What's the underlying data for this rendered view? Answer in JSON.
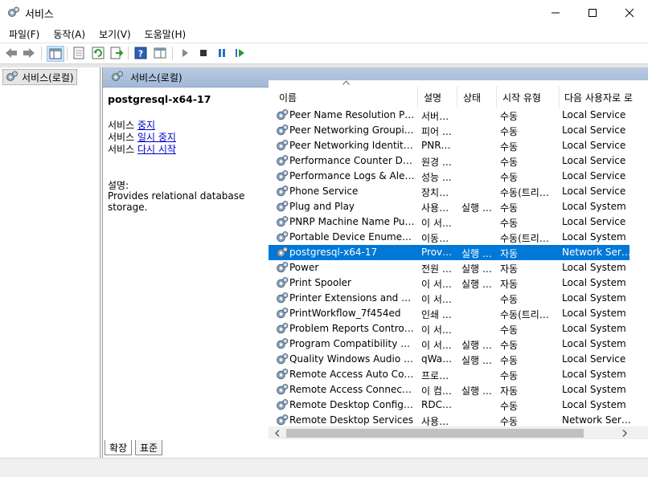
{
  "window": {
    "title": "서비스"
  },
  "menu": [
    "파일(F)",
    "동작(A)",
    "보기(V)",
    "도움말(H)"
  ],
  "tree": {
    "root_label": "서비스(로컬)"
  },
  "panel": {
    "header": "서비스(로컬)"
  },
  "detail": {
    "service_name": "postgresql-x64-17",
    "prefix": "서비스 ",
    "actions": [
      "중지",
      "일시 중지",
      "다시 시작"
    ],
    "desc_label": "설명:",
    "desc_text": "Provides relational database storage."
  },
  "columns": [
    "이름",
    "설명",
    "상태",
    "시작 유형",
    "다음 사용자로 로"
  ],
  "rows": [
    {
      "name": "Peer Name Resolution Prot…",
      "desc": "서버…",
      "status": "",
      "start": "수동",
      "logon": "Local Service"
    },
    {
      "name": "Peer Networking Grouping",
      "desc": "피어 …",
      "status": "",
      "start": "수동",
      "logon": "Local Service"
    },
    {
      "name": "Peer Networking Identity …",
      "desc": "PNR…",
      "status": "",
      "start": "수동",
      "logon": "Local Service"
    },
    {
      "name": "Performance Counter DLL …",
      "desc": "원경 …",
      "status": "",
      "start": "수동",
      "logon": "Local Service"
    },
    {
      "name": "Performance Logs & Alerts",
      "desc": "성능 …",
      "status": "",
      "start": "수동",
      "logon": "Local Service"
    },
    {
      "name": "Phone Service",
      "desc": "장치…",
      "status": "",
      "start": "수동(트리…",
      "logon": "Local Service"
    },
    {
      "name": "Plug and Play",
      "desc": "사용…",
      "status": "실행 …",
      "start": "수동",
      "logon": "Local System"
    },
    {
      "name": "PNRP Machine Name Publi…",
      "desc": "이 서…",
      "status": "",
      "start": "수동",
      "logon": "Local Service"
    },
    {
      "name": "Portable Device Enumerato…",
      "desc": "이동…",
      "status": "",
      "start": "수동(트리…",
      "logon": "Local System"
    },
    {
      "name": "postgresql-x64-17",
      "desc": "Provi…",
      "status": "실행 …",
      "start": "자동",
      "logon": "Network Service",
      "selected": true
    },
    {
      "name": "Power",
      "desc": "전원 …",
      "status": "실행 …",
      "start": "자동",
      "logon": "Local System"
    },
    {
      "name": "Print Spooler",
      "desc": "이 서…",
      "status": "실행 …",
      "start": "자동",
      "logon": "Local System"
    },
    {
      "name": "Printer Extensions and Noti…",
      "desc": "이 서…",
      "status": "",
      "start": "수동",
      "logon": "Local System"
    },
    {
      "name": "PrintWorkflow_7f454ed",
      "desc": "인쇄 …",
      "status": "",
      "start": "수동(트리…",
      "logon": "Local System"
    },
    {
      "name": "Problem Reports Control P…",
      "desc": "이 서…",
      "status": "",
      "start": "수동",
      "logon": "Local System"
    },
    {
      "name": "Program Compatibility Assi…",
      "desc": "이 서…",
      "status": "실행 …",
      "start": "수동",
      "logon": "Local System"
    },
    {
      "name": "Quality Windows Audio Vi…",
      "desc": "qWa…",
      "status": "실행 …",
      "start": "수동",
      "logon": "Local Service"
    },
    {
      "name": "Remote Access Auto Conn…",
      "desc": "프로…",
      "status": "",
      "start": "수동",
      "logon": "Local System"
    },
    {
      "name": "Remote Access Connection…",
      "desc": "이 컴…",
      "status": "실행 …",
      "start": "자동",
      "logon": "Local System"
    },
    {
      "name": "Remote Desktop Configura…",
      "desc": "RDC…",
      "status": "",
      "start": "수동",
      "logon": "Local System"
    },
    {
      "name": "Remote Desktop Services",
      "desc": "사용…",
      "status": "",
      "start": "수동",
      "logon": "Network Service"
    }
  ],
  "tabs": [
    "확장",
    "표준"
  ],
  "colors": {
    "selection": "#0078d7",
    "header": "#b9cbe3",
    "link": "#0000cc"
  }
}
